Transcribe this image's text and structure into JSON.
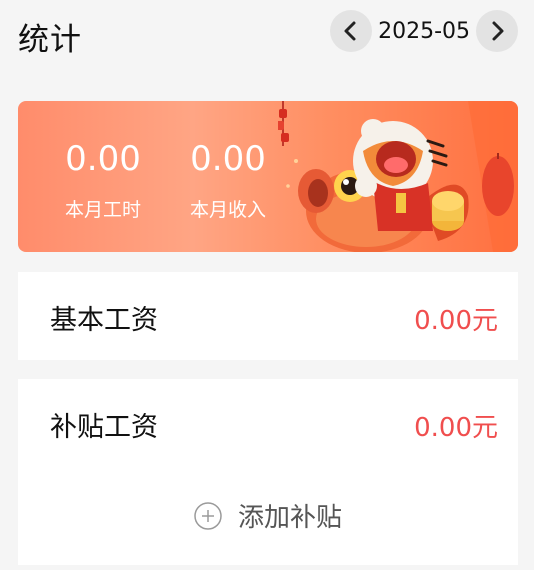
{
  "header": {
    "title": "统计",
    "month": "2025-05"
  },
  "banner": {
    "hours_value": "0.00",
    "hours_label": "本月工时",
    "income_value": "0.00",
    "income_label": "本月收入"
  },
  "basic_wage": {
    "label": "基本工资",
    "value": "0.00元"
  },
  "allowance_wage": {
    "label": "补贴工资",
    "value": "0.00元",
    "add_label": "添加补贴"
  },
  "colors": {
    "accent_red": "#f04e4e",
    "banner_orange": "#ff8c6b",
    "background": "#f5f5f5"
  }
}
